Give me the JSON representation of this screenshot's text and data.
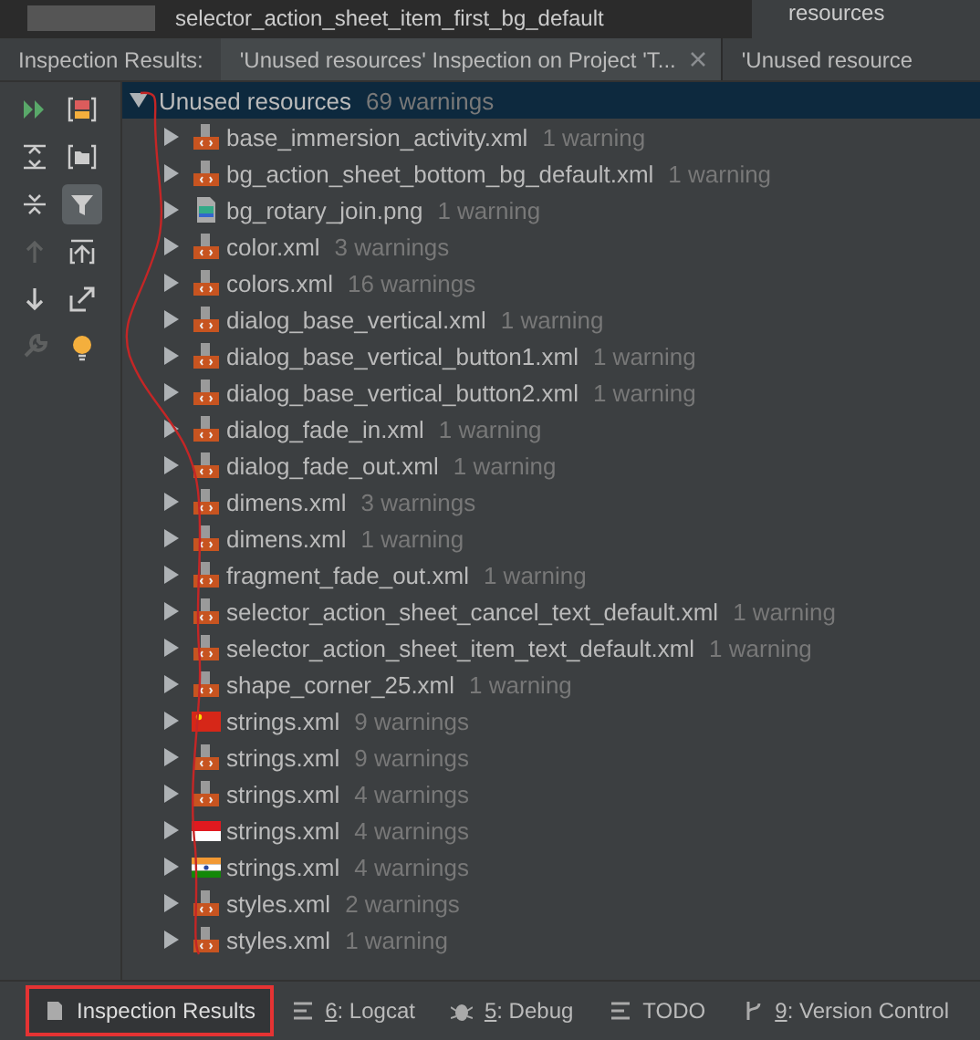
{
  "editor_strip": {
    "lines": [
      "selector_action_sheet_item_first_bg_default"
    ],
    "side_text": "resources"
  },
  "header": {
    "label": "Inspection Results:",
    "tabs": [
      {
        "title": "'Unused resources' Inspection on Project 'T...",
        "selected": true,
        "closable": true
      },
      {
        "title": "'Unused resource",
        "selected": false,
        "closable": false
      }
    ]
  },
  "tree": {
    "root": {
      "name": "Unused resources",
      "count": "69 warnings",
      "expanded": true,
      "selected": true
    },
    "items": [
      {
        "name": "base_immersion_activity.xml",
        "count": "1 warning",
        "kind": "xml"
      },
      {
        "name": "bg_action_sheet_bottom_bg_default.xml",
        "count": "1 warning",
        "kind": "xml"
      },
      {
        "name": "bg_rotary_join.png",
        "count": "1 warning",
        "kind": "png"
      },
      {
        "name": "color.xml",
        "count": "3 warnings",
        "kind": "xml"
      },
      {
        "name": "colors.xml",
        "count": "16 warnings",
        "kind": "xml"
      },
      {
        "name": "dialog_base_vertical.xml",
        "count": "1 warning",
        "kind": "xml"
      },
      {
        "name": "dialog_base_vertical_button1.xml",
        "count": "1 warning",
        "kind": "xml"
      },
      {
        "name": "dialog_base_vertical_button2.xml",
        "count": "1 warning",
        "kind": "xml"
      },
      {
        "name": "dialog_fade_in.xml",
        "count": "1 warning",
        "kind": "xml"
      },
      {
        "name": "dialog_fade_out.xml",
        "count": "1 warning",
        "kind": "xml"
      },
      {
        "name": "dimens.xml",
        "count": "3 warnings",
        "kind": "xml"
      },
      {
        "name": "dimens.xml",
        "count": "1 warning",
        "kind": "xml"
      },
      {
        "name": "fragment_fade_out.xml",
        "count": "1 warning",
        "kind": "xml"
      },
      {
        "name": "selector_action_sheet_cancel_text_default.xml",
        "count": "1 warning",
        "kind": "xml"
      },
      {
        "name": "selector_action_sheet_item_text_default.xml",
        "count": "1 warning",
        "kind": "xml"
      },
      {
        "name": "shape_corner_25.xml",
        "count": "1 warning",
        "kind": "xml"
      },
      {
        "name": "strings.xml",
        "count": "9 warnings",
        "kind": "flag_cn"
      },
      {
        "name": "strings.xml",
        "count": "9 warnings",
        "kind": "xml"
      },
      {
        "name": "strings.xml",
        "count": "4 warnings",
        "kind": "xml"
      },
      {
        "name": "strings.xml",
        "count": "4 warnings",
        "kind": "flag_id"
      },
      {
        "name": "strings.xml",
        "count": "4 warnings",
        "kind": "flag_in"
      },
      {
        "name": "styles.xml",
        "count": "2 warnings",
        "kind": "xml"
      },
      {
        "name": "styles.xml",
        "count": "1 warning",
        "kind": "xml"
      }
    ]
  },
  "tool_tabs": [
    {
      "label": "Inspection Results",
      "kind": "inspect",
      "selected": true
    },
    {
      "number": "6",
      "label": ": Logcat",
      "kind": "logcat",
      "selected": false
    },
    {
      "number": "5",
      "label": ": Debug",
      "kind": "debug",
      "selected": false
    },
    {
      "label": "TODO",
      "kind": "todo",
      "selected": false
    },
    {
      "number": "9",
      "label": ": Version Control",
      "kind": "vcs",
      "selected": false
    }
  ]
}
